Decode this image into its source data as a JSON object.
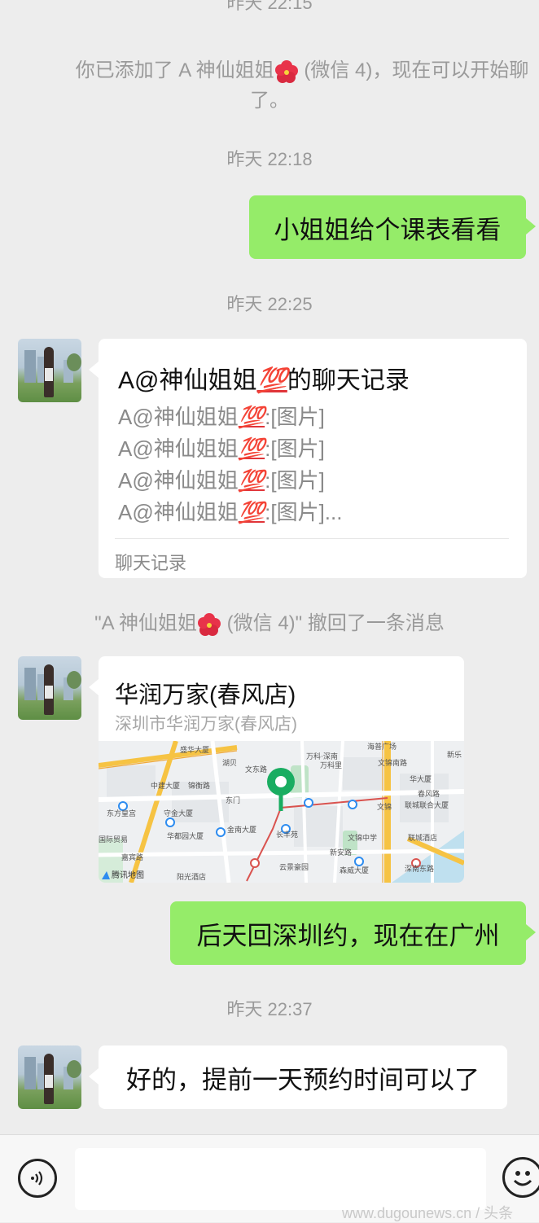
{
  "top_partial_time": "昨天 22:15",
  "system_added": {
    "prefix": "你已添加了 A 神仙姐姐",
    "suffix": " (微信 4)，现在可以开始聊",
    "line2": "了。"
  },
  "times": {
    "t1": "昨天 22:18",
    "t2": "昨天 22:25",
    "t3": "昨天 22:37"
  },
  "msg_sent_1": "小姐姐给个课表看看",
  "chat_record": {
    "title_prefix": "A@神仙姐姐",
    "title_suffix": "的聊天记录",
    "lines": [
      {
        "name": "A@神仙姐姐",
        "text": ":[图片]"
      },
      {
        "name": "A@神仙姐姐",
        "text": ":[图片]"
      },
      {
        "name": "A@神仙姐姐",
        "text": ":[图片]"
      },
      {
        "name": "A@神仙姐姐",
        "text": ":[图片]..."
      }
    ],
    "emoji_text": "💯",
    "footer": "聊天记录"
  },
  "recall_notice": {
    "prefix": "\"A 神仙姐姐",
    "suffix": " (微信 4)\" 撤回了一条消息"
  },
  "location": {
    "title": "华润万家(春风店)",
    "address": "深圳市华润万家(春风店)",
    "map_labels": {
      "l1": "盛华大厦",
      "l2": "湖贝",
      "l3": "文东路",
      "l4": "万科·深南",
      "l5": "万科里",
      "l6": "海普广场",
      "l7": "文锦南路",
      "l8": "华大厦",
      "l9": "新乐",
      "l10": "中建大厦",
      "l11": "锦衡路",
      "l12": "东方皇宫",
      "l13": "守金大厦",
      "l14": "东门",
      "l15": "春风路",
      "l16": "联城联合大厦",
      "l17": "文锦",
      "l18": "国际贸易",
      "l19": "华都园大厦",
      "l20": "金南大厦",
      "l21": "长丰苑",
      "l22": "文锦中学",
      "l23": "联城酒店",
      "l24": "嘉宾路",
      "l25": "新安路",
      "l26": "云景豪园",
      "l27": "森威大厦",
      "l28": "腾讯地图",
      "l29": "阳光酒店",
      "l30": "深南东路"
    }
  },
  "msg_sent_2": "后天回深圳约，现在在广州",
  "msg_recv_3": "好的，提前一天预约时间可以了",
  "watermark": "www.dugounews.cn / 头条",
  "colors": {
    "background": "#ededed",
    "sent_bubble": "#95ec69",
    "received_bubble": "#ffffff",
    "system_text": "#9a9a9a",
    "map_pin": "#1aad61",
    "route": "#d9534f"
  }
}
